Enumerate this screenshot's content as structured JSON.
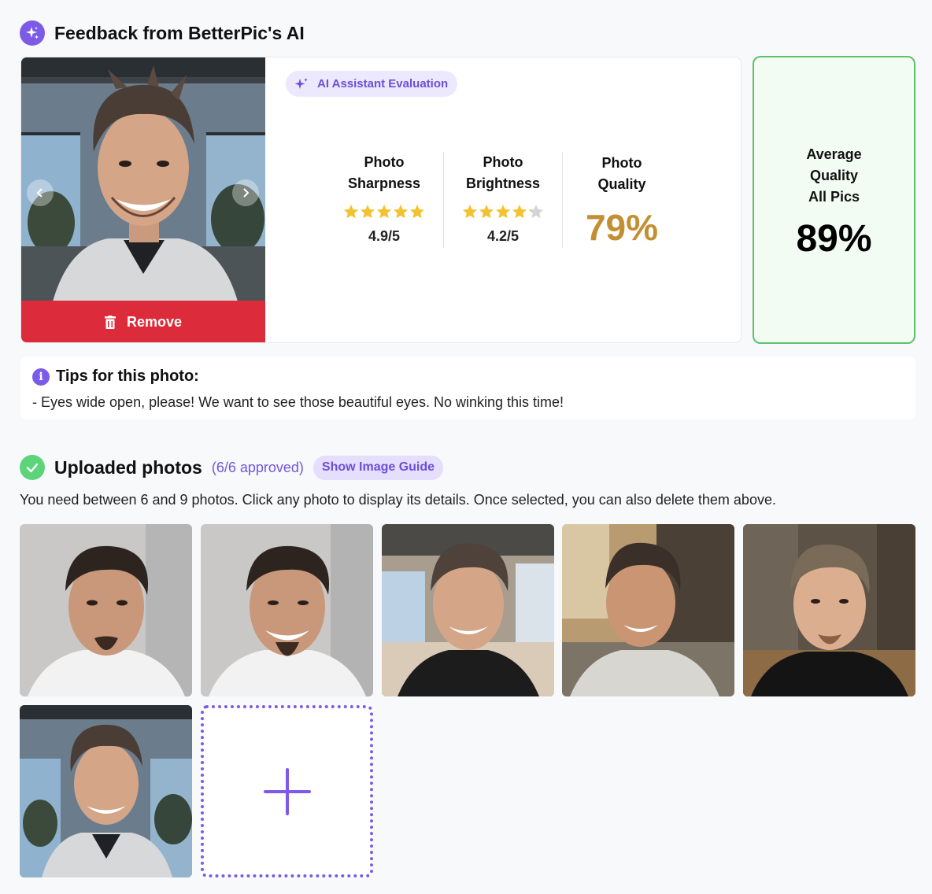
{
  "feedback": {
    "title": "Feedback from BetterPic's AI",
    "icon": "sparkle-icon",
    "badge": "AI Assistant Evaluation",
    "remove_label": "Remove",
    "metrics": [
      {
        "name_line1": "Photo",
        "name_line2": "Sharpness",
        "score": "4.9/5",
        "rating": 4.9
      },
      {
        "name_line1": "Photo",
        "name_line2": "Brightness",
        "score": "4.2/5",
        "rating": 4.2
      },
      {
        "name_line1": "Photo",
        "name_line2": "Quality",
        "percent": "79%"
      }
    ],
    "average": {
      "line1": "Average",
      "line2": "Quality",
      "line3": "All Pics",
      "percent": "89%"
    }
  },
  "tips": {
    "title": "Tips for this photo:",
    "text": "- Eyes wide open, please! We want to see those beautiful eyes. No winking this time!"
  },
  "uploaded": {
    "title": "Uploaded photos",
    "approved": "(6/6 approved)",
    "guide_label": "Show Image Guide",
    "instructions": "You need between 6 and 9 photos. Click any photo to display its details. Once selected, you can also delete them above.",
    "photo_count": 6
  },
  "colors": {
    "accent": "#7c5ce6",
    "danger": "#dc2b3a",
    "success": "#5cc36a",
    "star": "#f2c230",
    "quality": "#c28f33"
  }
}
